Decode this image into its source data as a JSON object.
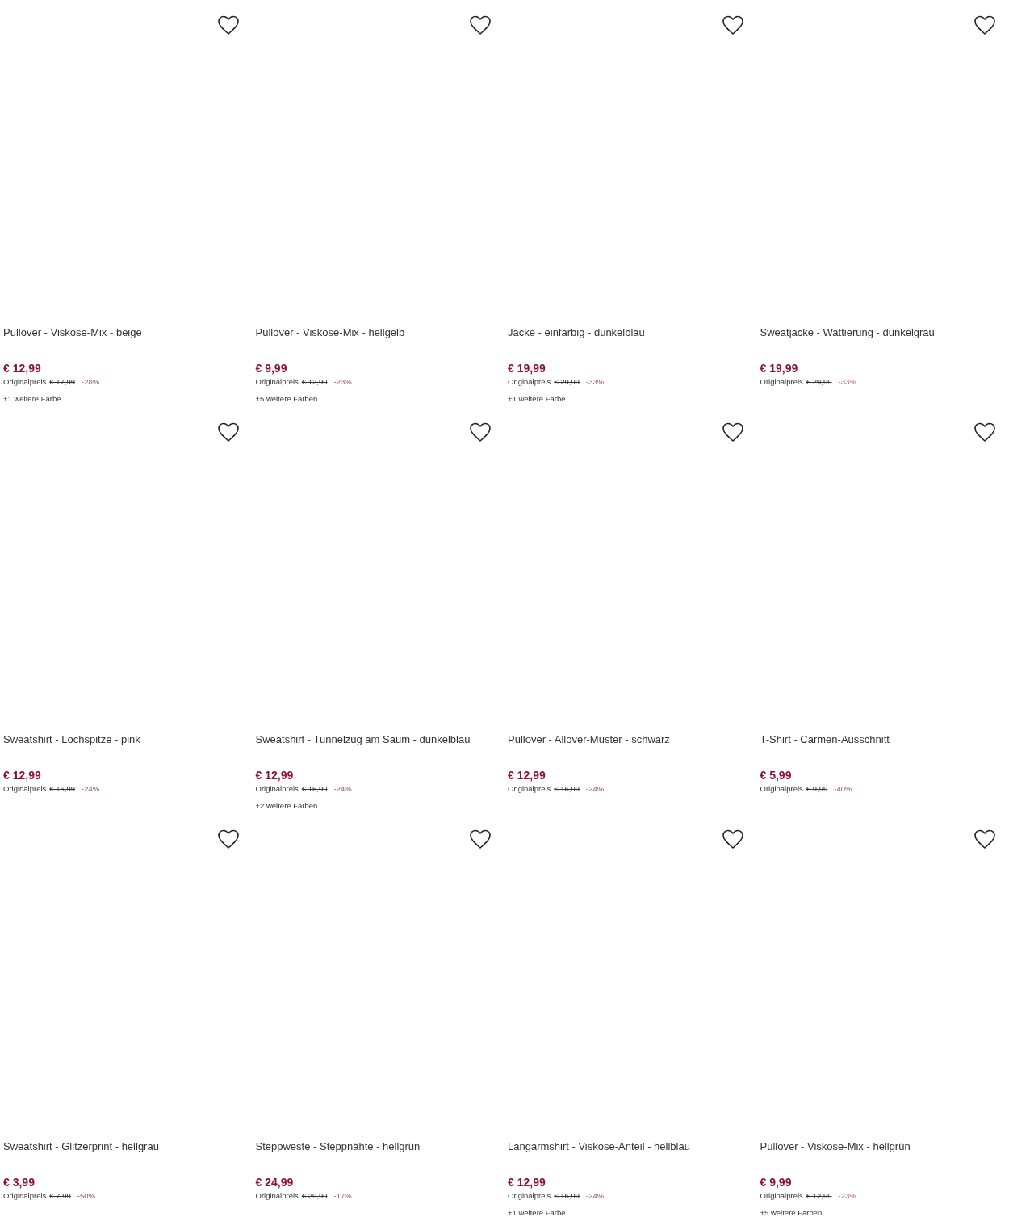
{
  "products": [
    {
      "title": "Pullover - Viskose-Mix - beige",
      "price": "€ 12,99",
      "original_label": "Originalpreis",
      "original_price": "€ 17,99",
      "discount": "-28%",
      "more_colors": "+1 weitere Farbe"
    },
    {
      "title": "Pullover - Viskose-Mix - hellgelb",
      "price": "€ 9,99",
      "original_label": "Originalpreis",
      "original_price": "€ 12,99",
      "discount": "-23%",
      "more_colors": "+5 weitere Farben"
    },
    {
      "title": "Jacke - einfarbig - dunkelblau",
      "price": "€ 19,99",
      "original_label": "Originalpreis",
      "original_price": "€ 29,99",
      "discount": "-33%",
      "more_colors": "+1 weitere Farbe"
    },
    {
      "title": "Sweatjacke - Wattierung - dunkelgrau",
      "price": "€ 19,99",
      "original_label": "Originalpreis",
      "original_price": "€ 29,99",
      "discount": "-33%"
    },
    {
      "title": "Sweatshirt - Lochspitze - pink",
      "price": "€ 12,99",
      "original_label": "Originalpreis",
      "original_price": "€ 16,99",
      "discount": "-24%"
    },
    {
      "title": "Sweatshirt - Tunnelzug am Saum - dunkelblau",
      "price": "€ 12,99",
      "original_label": "Originalpreis",
      "original_price": "€ 16,99",
      "discount": "-24%",
      "more_colors": "+2 weitere Farben"
    },
    {
      "title": "Pullover - Allover-Muster - schwarz",
      "price": "€ 12,99",
      "original_label": "Originalpreis",
      "original_price": "€ 16,99",
      "discount": "-24%"
    },
    {
      "title": "T-Shirt - Carmen-Ausschnitt",
      "price": "€ 5,99",
      "original_label": "Originalpreis",
      "original_price": "€ 9,99",
      "discount": "-40%"
    },
    {
      "title": "Sweatshirt - Glitzerprint - hellgrau",
      "price": "€ 3,99",
      "original_label": "Originalpreis",
      "original_price": "€ 7,99",
      "discount": "-50%"
    },
    {
      "title": "Steppweste - Steppnähte - hellgrün",
      "price": "€ 24,99",
      "original_label": "Originalpreis",
      "original_price": "€ 29,99",
      "discount": "-17%"
    },
    {
      "title": "Langarmshirt - Viskose-Anteil - hellblau",
      "price": "€ 12,99",
      "original_label": "Originalpreis",
      "original_price": "€ 16,99",
      "discount": "-24%",
      "more_colors": "+1 weitere Farbe"
    },
    {
      "title": "Pullover - Viskose-Mix - hellgrün",
      "price": "€ 9,99",
      "original_label": "Originalpreis",
      "original_price": "€ 12,99",
      "discount": "-23%",
      "more_colors": "+5 weitere Farben"
    }
  ]
}
